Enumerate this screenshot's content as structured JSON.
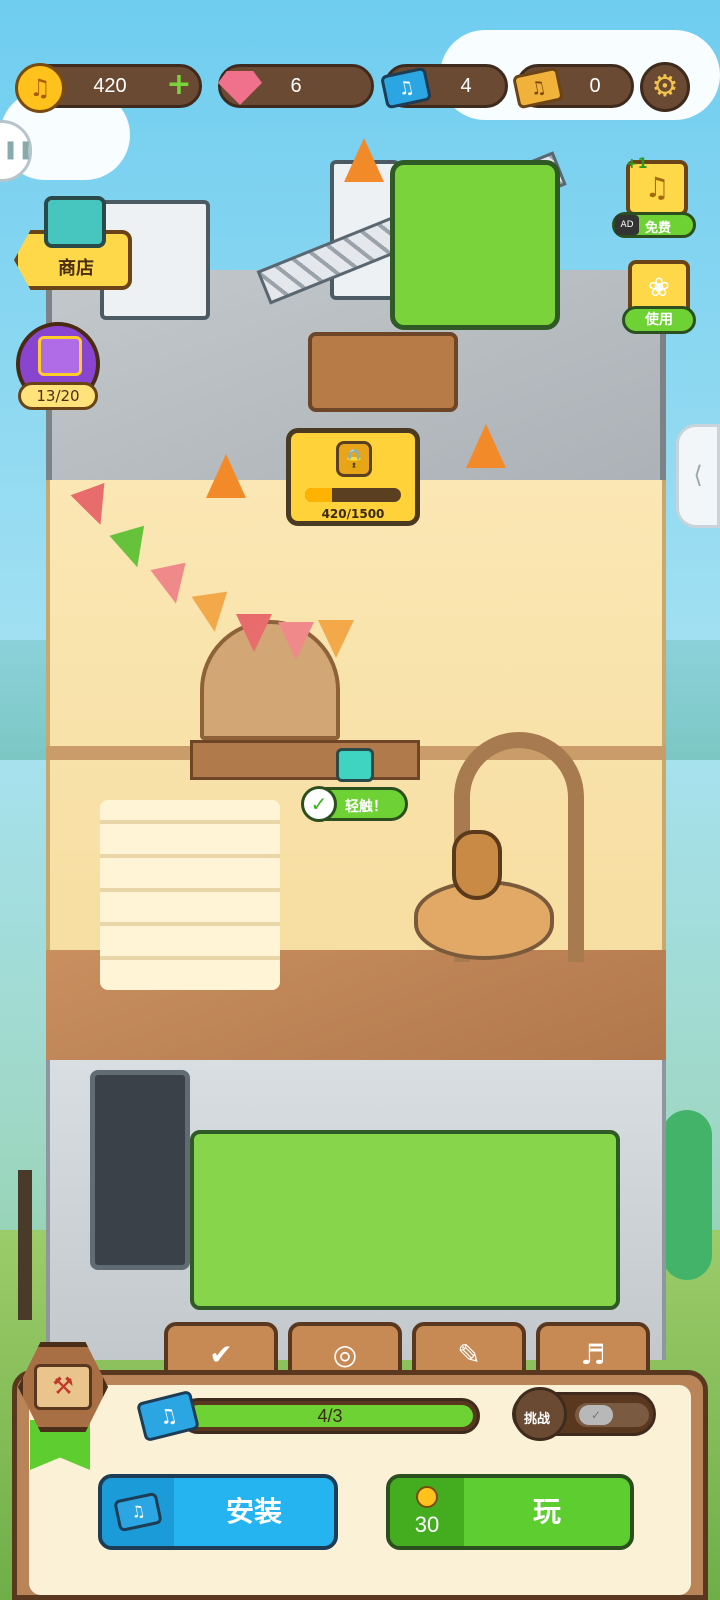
{
  "hud": {
    "coins": "420",
    "gems": "6",
    "music_tickets": "4",
    "gold_tickets": "0",
    "icons": [
      "coin-icon",
      "gem-icon",
      "music-ticket-icon",
      "gold-ticket-icon",
      "gear-icon",
      "plus-icon"
    ]
  },
  "left_menu": {
    "shop_label": "商店",
    "gift_progress": "13/20"
  },
  "right_menu": {
    "free_plus": "+1",
    "ad_badge": "AD",
    "free_label": "免费",
    "use_label": "使用"
  },
  "construction": {
    "lock_progress_text": "420/1500",
    "lock_progress_fraction": 0.28
  },
  "scene": {
    "tip_text": "轻触！"
  },
  "bottom_panel": {
    "tabs": [
      "check-tab-icon",
      "target-tab-icon",
      "book-tab-icon",
      "music-list-tab-icon"
    ],
    "progress_text": "4/3",
    "progress_fraction": 1.0,
    "challenge_label": "挑战",
    "install_label": "安装",
    "play_cost": "30",
    "play_label": "玩"
  },
  "colors": {
    "accent_green": "#6ed134",
    "accent_blue": "#25b4f0",
    "wood": "#b98457",
    "coin": "#ffc21d"
  }
}
